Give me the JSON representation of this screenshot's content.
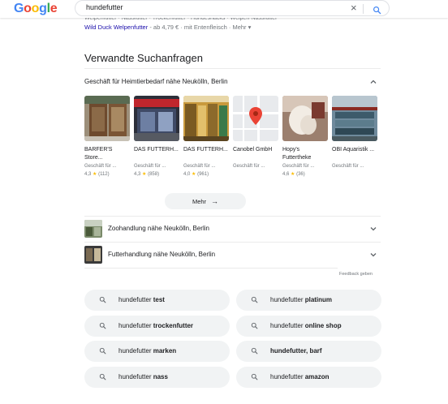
{
  "header": {
    "logo": "Google",
    "query": "hundefutter",
    "clear_icon": "close-icon",
    "search_icon": "search-icon"
  },
  "prev_result": {
    "cutoff_text": "Welpenfutter · Nassfutter · Trockenfutter · Hundesnacks · Welpen-Nassfutter",
    "link": "Wild Duck Welpenfutter",
    "meta": " - ab 4,79 € · mit Entenfleisch · ",
    "more": "Mehr ▾"
  },
  "related": {
    "title": "Verwandte Suchanfragen",
    "group_title": "Geschäft für Heimtierbedarf nähe Neukölln, Berlin",
    "cards": [
      {
        "name": "BARFER'S Store...",
        "type": "Geschäft für ...",
        "rating": "4,3",
        "reviews": "(112)"
      },
      {
        "name": "DAS FUTTERH...",
        "type": "Geschäft für ...",
        "rating": "4,3",
        "reviews": "(858)"
      },
      {
        "name": "DAS FUTTERH...",
        "type": "Geschäft für ...",
        "rating": "4,0",
        "reviews": "(961)"
      },
      {
        "name": "Canobel GmbH",
        "type": "Geschäft für ...",
        "rating": "",
        "reviews": ""
      },
      {
        "name": "Hopy's Futtertheke",
        "type": "Geschäft für ...",
        "rating": "4,6",
        "reviews": "(36)"
      },
      {
        "name": "OBI Aquaristik ...",
        "type": "Geschäft für ...",
        "rating": "",
        "reviews": ""
      }
    ],
    "more_button": "Mehr",
    "rows": [
      {
        "label": "Zoohandlung nähe Neukölln, Berlin"
      },
      {
        "label": "Futterhandlung nähe Neukölln, Berlin"
      }
    ],
    "feedback": "Feedback geben"
  },
  "suggestions": [
    {
      "prefix": "hundefutter ",
      "bold": "test"
    },
    {
      "prefix": "hundefutter ",
      "bold": "platinum"
    },
    {
      "prefix": "hundefutter ",
      "bold": "trockenfutter"
    },
    {
      "prefix": "hundefutter ",
      "bold": "online shop"
    },
    {
      "prefix": "hundefutter ",
      "bold": "marken"
    },
    {
      "prefix": "",
      "bold": "hundefutter, barf"
    },
    {
      "prefix": "hundefutter ",
      "bold": "nass"
    },
    {
      "prefix": "hundefutter ",
      "bold": "amazon"
    }
  ],
  "colors": {
    "link": "#1a0dab",
    "star": "#fbbc04",
    "pill_bg": "#f1f3f4"
  }
}
